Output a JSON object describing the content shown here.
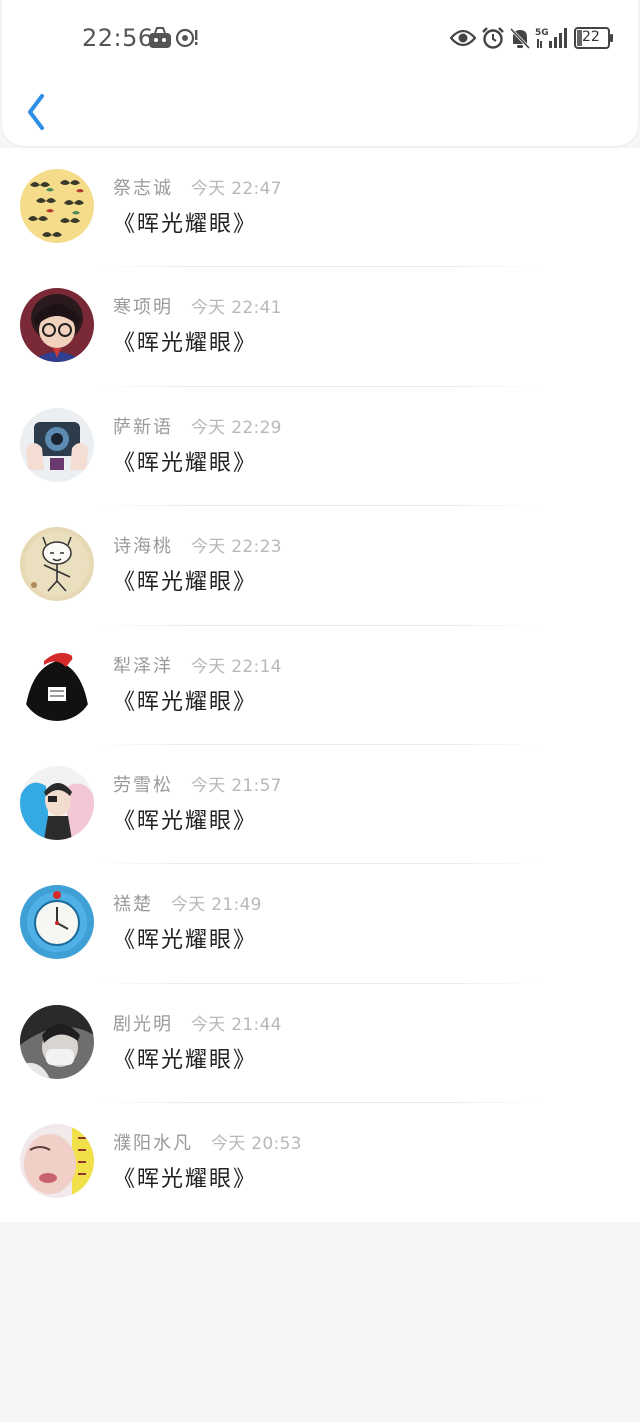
{
  "status_bar": {
    "time": "22:56",
    "battery": "22",
    "network": "5G",
    "icons": [
      "game-controller-icon",
      "nfc-icon",
      "eye-icon",
      "alarm-icon",
      "bell-muted-icon",
      "5g-signal-icon",
      "battery-icon"
    ]
  },
  "header": {
    "back_icon": "chevron-left-icon",
    "accent": "#2f8ee6"
  },
  "messages": [
    {
      "name": "祭志诚",
      "time": "今天 22:47",
      "text": "《晖光耀眼》"
    },
    {
      "name": "寒项明",
      "time": "今天 22:41",
      "text": "《晖光耀眼》"
    },
    {
      "name": "萨新语",
      "time": "今天 22:29",
      "text": "《晖光耀眼》"
    },
    {
      "name": "诗海桃",
      "time": "今天 22:23",
      "text": "《晖光耀眼》"
    },
    {
      "name": "犁泽洋",
      "time": "今天 22:14",
      "text": "《晖光耀眼》"
    },
    {
      "name": "劳雪松",
      "time": "今天 21:57",
      "text": "《晖光耀眼》"
    },
    {
      "name": "禚楚",
      "time": "今天 21:49",
      "text": "《晖光耀眼》"
    },
    {
      "name": "剧光明",
      "time": "今天 21:44",
      "text": "《晖光耀眼》"
    },
    {
      "name": "濮阳水凡",
      "time": "今天 20:53",
      "text": "《晖光耀眼》"
    }
  ]
}
